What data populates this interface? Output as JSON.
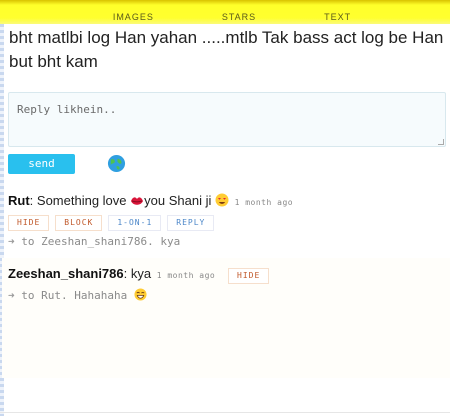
{
  "nav": {
    "tabs": [
      "IMAGES",
      "STARS",
      "TEXT"
    ]
  },
  "post": {
    "text": "bht matlbi log Han yahan .....mtlb Tak bass act log be Han but bht kam"
  },
  "reply_form": {
    "placeholder": "Reply likhein..",
    "send_label": "send"
  },
  "comments": [
    {
      "user": "Rut",
      "message_a": "Something love ",
      "message_b": "you Shani ji ",
      "time": "1 month ago",
      "actions": [
        "HIDE",
        "BLOCK",
        "1-ON-1",
        "REPLY"
      ],
      "to_label": "to Zeeshan_shani786",
      "to_text": "kya"
    },
    {
      "user": "Zeeshan_shani786",
      "message": "kya",
      "time": "1 month ago",
      "hide_label": "HIDE",
      "to_label": "to Rut",
      "to_text": "Hahahaha"
    }
  ],
  "colors": {
    "topbar": "#ffff2e",
    "send_button": "#29c0ee",
    "action_red": "#c0582a",
    "action_blue": "#4b86c8"
  },
  "icons": [
    "globe-icon",
    "lips-icon",
    "heart-eyes-icon",
    "arrow-right-icon",
    "grin-icon"
  ]
}
